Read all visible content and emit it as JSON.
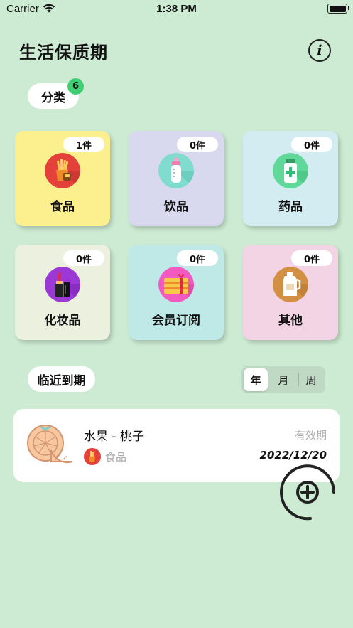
{
  "status": {
    "carrier": "Carrier",
    "time": "1:38 PM"
  },
  "header": {
    "title": "生活保质期",
    "info_icon": "info-icon"
  },
  "category_section": {
    "label": "分类",
    "badge": "6"
  },
  "categories": [
    {
      "name": "食品",
      "count": "1件",
      "bg": "#fcf08e",
      "icon": "fries-icon",
      "icon_bg": "#e3413a"
    },
    {
      "name": "饮品",
      "count": "0件",
      "bg": "#d8d8ee",
      "icon": "baby-bottle-icon",
      "icon_bg": "#7fdccf"
    },
    {
      "name": "药品",
      "count": "0件",
      "bg": "#d3ecf2",
      "icon": "medicine-bottle-icon",
      "icon_bg": "#5fd89a"
    },
    {
      "name": "化妆品",
      "count": "0件",
      "bg": "#ebf1de",
      "icon": "lipstick-icon",
      "icon_bg": "#9b38d6"
    },
    {
      "name": "会员订阅",
      "count": "0件",
      "bg": "#bfe9e6",
      "icon": "gift-card-icon",
      "icon_bg": "#f25ac0"
    },
    {
      "name": "其他",
      "count": "0件",
      "bg": "#f2d4e4",
      "icon": "jug-icon",
      "icon_bg": "#d39044"
    }
  ],
  "expiring_section": {
    "label": "临近到期",
    "filters": [
      "年",
      "月",
      "周"
    ],
    "active_filter": "年"
  },
  "items": [
    {
      "name": "水果 - 桃子",
      "category": "食品",
      "expiry_label": "有效期",
      "expiry_date": "2022/12/20",
      "icon": "orange-slice-icon"
    }
  ],
  "fab": {
    "icon": "add-icon"
  }
}
